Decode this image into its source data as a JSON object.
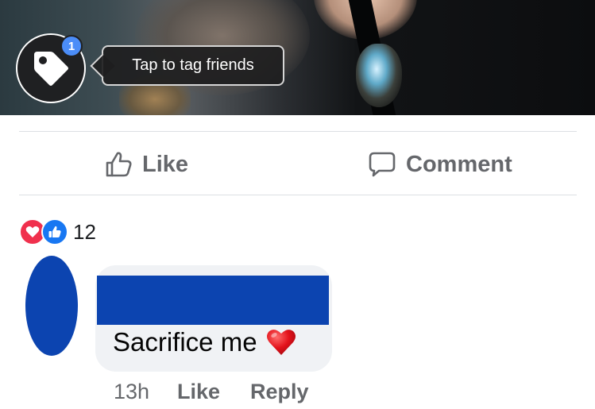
{
  "photo": {
    "tag_badge_count": "1",
    "tag_tooltip": "Tap to tag friends",
    "tag_icon": "tag-icon"
  },
  "actions": {
    "like_label": "Like",
    "comment_label": "Comment",
    "like_icon": "thumbs-up-outline-icon",
    "comment_icon": "speech-bubble-outline-icon"
  },
  "reactions": {
    "types": [
      "love-reaction-icon",
      "like-reaction-icon"
    ],
    "count": "12",
    "colors": {
      "love": "#f0304d",
      "like": "#1877f2"
    }
  },
  "comment": {
    "text": "Sacrifice me",
    "emoji": "red-heart-icon",
    "time": "13h",
    "like_label": "Like",
    "reply_label": "Reply",
    "redaction_color": "#0c44b0"
  }
}
